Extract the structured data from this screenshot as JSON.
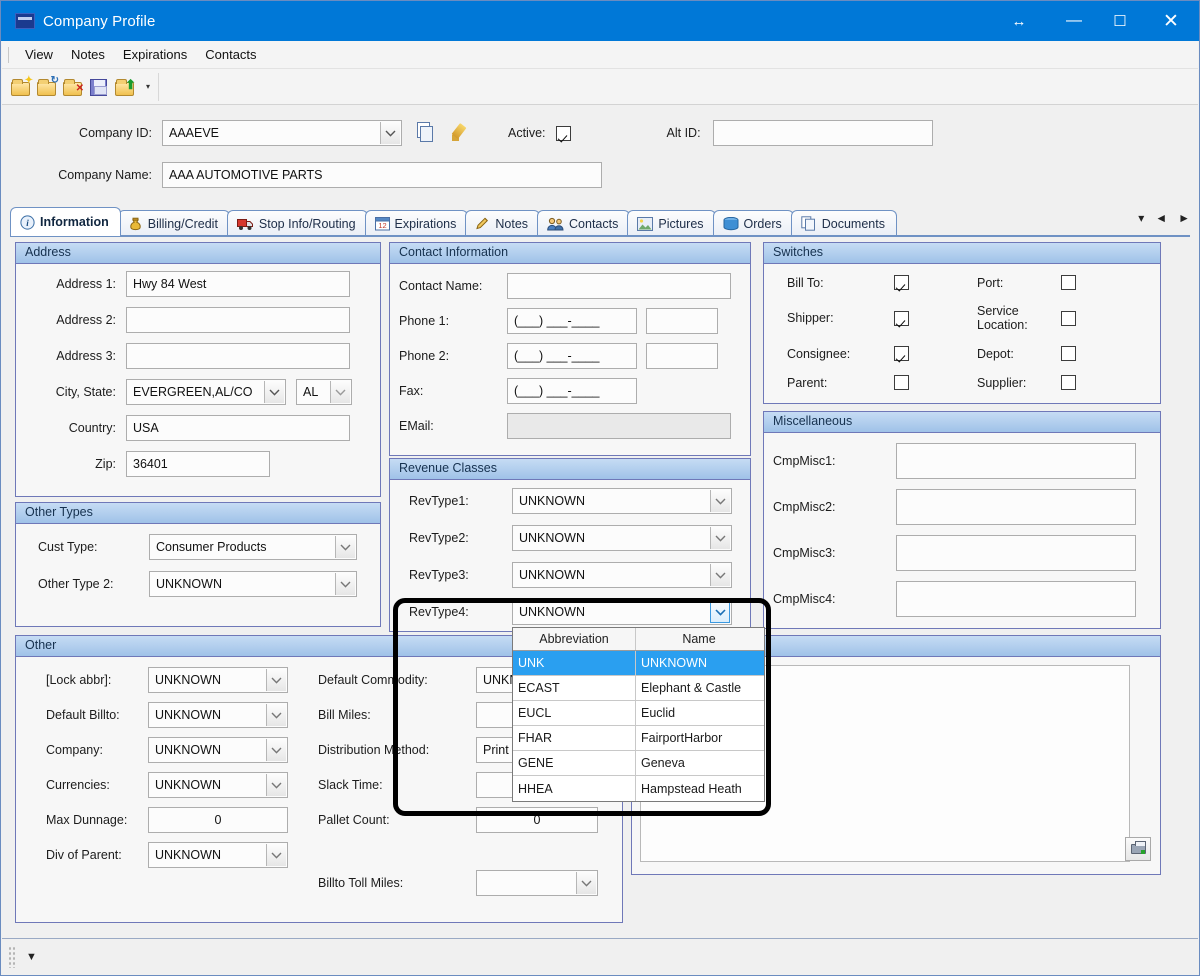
{
  "window": {
    "title": "Company Profile",
    "icon": "app-icon",
    "controls": {
      "resize": "↔",
      "minimize": "—",
      "maximize": "☐",
      "close": "✕"
    }
  },
  "menu": {
    "items": [
      "View",
      "Notes",
      "Expirations",
      "Contacts"
    ]
  },
  "toolbar": {
    "buttons": [
      "new-folder-icon",
      "open-folder-icon",
      "delete-folder-icon",
      "save-icon",
      "export-folder-icon"
    ],
    "overflow": "▾"
  },
  "header": {
    "company_id_label": "Company ID:",
    "company_id_value": "AAAEVE",
    "copy_icon": "copy-document-icon",
    "edit_icon": "pencil-icon",
    "active_label": "Active:",
    "active_checked": true,
    "alt_id_label": "Alt ID:",
    "alt_id_value": "",
    "company_name_label": "Company Name:",
    "company_name_value": "AAA AUTOMOTIVE PARTS"
  },
  "tabs": {
    "items": [
      {
        "label": "Information",
        "icon": "info-icon",
        "selected": true
      },
      {
        "label": "Billing/Credit",
        "icon": "money-bag-icon",
        "selected": false
      },
      {
        "label": "Stop Info/Routing",
        "icon": "truck-icon",
        "selected": false
      },
      {
        "label": "Expirations",
        "icon": "calendar-icon",
        "selected": false
      },
      {
        "label": "Notes",
        "icon": "pencil-icon",
        "selected": false
      },
      {
        "label": "Contacts",
        "icon": "people-icon",
        "selected": false
      },
      {
        "label": "Pictures",
        "icon": "picture-icon",
        "selected": false
      },
      {
        "label": "Orders",
        "icon": "barrel-icon",
        "selected": false
      },
      {
        "label": "Documents",
        "icon": "documents-icon",
        "selected": false
      }
    ],
    "nav": {
      "dropdown": "▾",
      "prev": "◄",
      "next": "►"
    }
  },
  "address": {
    "caption": "Address",
    "fields": [
      {
        "label": "Address 1:",
        "value": "Hwy 84 West"
      },
      {
        "label": "Address 2:",
        "value": ""
      },
      {
        "label": "Address 3:",
        "value": ""
      }
    ],
    "city_state_label": "City, State:",
    "city_state_value": "EVERGREEN,AL/CO",
    "state_value": "AL",
    "country_label": "Country:",
    "country_value": "USA",
    "zip_label": "Zip:",
    "zip_value": "36401"
  },
  "other_types": {
    "caption": "Other Types",
    "cust_type_label": "Cust Type:",
    "cust_type_value": "Consumer Products",
    "other_type2_label": "Other Type 2:",
    "other_type2_value": "UNKNOWN"
  },
  "contact_information": {
    "caption": "Contact Information",
    "contact_name_label": "Contact Name:",
    "contact_name_value": "",
    "phone1_label": "Phone 1:",
    "phone1_value": "(___) ___-____",
    "phone1_ext": "",
    "phone2_label": "Phone 2:",
    "phone2_value": "(___) ___-____",
    "phone2_ext": "",
    "fax_label": "Fax:",
    "fax_value": "(___) ___-____",
    "email_label": "EMail:",
    "email_value": ""
  },
  "revenue_classes": {
    "caption": "Revenue Classes",
    "rows": [
      {
        "label": "RevType1:",
        "value": "UNKNOWN"
      },
      {
        "label": "RevType2:",
        "value": "UNKNOWN"
      },
      {
        "label": "RevType3:",
        "value": "UNKNOWN"
      },
      {
        "label": "RevType4:",
        "value": "UNKNOWN"
      }
    ]
  },
  "revtype4_dropdown": {
    "open": true,
    "columns": [
      "Abbreviation",
      "Name"
    ],
    "rows": [
      {
        "abbreviation": "UNK",
        "name": "UNKNOWN",
        "selected": true
      },
      {
        "abbreviation": "ECAST",
        "name": "Elephant & Castle",
        "selected": false
      },
      {
        "abbreviation": "EUCL",
        "name": "Euclid",
        "selected": false
      },
      {
        "abbreviation": "FHAR",
        "name": "FairportHarbor",
        "selected": false
      },
      {
        "abbreviation": "GENE",
        "name": "Geneva",
        "selected": false
      },
      {
        "abbreviation": "HHEA",
        "name": "Hampstead Heath",
        "selected": false
      }
    ]
  },
  "switches": {
    "caption": "Switches",
    "left": [
      {
        "label": "Bill To:",
        "checked": true
      },
      {
        "label": "Shipper:",
        "checked": true
      },
      {
        "label": "Consignee:",
        "checked": true
      },
      {
        "label": "Parent:",
        "checked": false
      }
    ],
    "right": [
      {
        "label": "Port:",
        "checked": false
      },
      {
        "label": "Service Location:",
        "checked": false
      },
      {
        "label": "Depot:",
        "checked": false
      },
      {
        "label": "Supplier:",
        "checked": false
      }
    ]
  },
  "miscellaneous": {
    "caption": "Miscellaneous",
    "rows": [
      {
        "label": "CmpMisc1:",
        "value": ""
      },
      {
        "label": "CmpMisc2:",
        "value": ""
      },
      {
        "label": "CmpMisc3:",
        "value": ""
      },
      {
        "label": "CmpMisc4:",
        "value": ""
      }
    ]
  },
  "other": {
    "caption": "Other",
    "col1": [
      {
        "label": "[Lock abbr]:",
        "value": "UNKNOWN",
        "type": "combo"
      },
      {
        "label": "Default Billto:",
        "value": "UNKNOWN",
        "type": "combo"
      },
      {
        "label": "Company:",
        "value": "UNKNOWN",
        "type": "combo"
      },
      {
        "label": "Currencies:",
        "value": "UNKNOWN",
        "type": "combo"
      },
      {
        "label": "Max Dunnage:",
        "value": "0",
        "type": "number"
      },
      {
        "label": "Div of Parent:",
        "value": "UNKNOWN",
        "type": "combo"
      }
    ],
    "col2": [
      {
        "label": "Default Commodity:",
        "value": "UNKNOWN",
        "type": "combo"
      },
      {
        "label": "Bill Miles:",
        "value": "",
        "type": "text"
      },
      {
        "label": "Distribution Method:",
        "value": "Print Copy",
        "type": "combo"
      },
      {
        "label": "Slack Time:",
        "value": "",
        "type": "text"
      },
      {
        "label": "Pallet Count:",
        "value": "0",
        "type": "number"
      }
    ],
    "billto_toll_label": "Billto Toll Miles:",
    "billto_toll_value": "",
    "print_icon": "print-icon"
  },
  "statusbar": {
    "grip": "resize-grip",
    "arrow": "▼"
  }
}
